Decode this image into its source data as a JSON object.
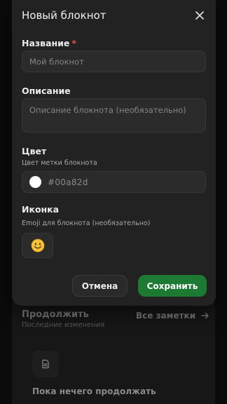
{
  "background": {
    "continue_title": "Продолжить",
    "continue_subtitle": "Последние изменения",
    "all_notes_link": "Все заметки",
    "empty_state": "Пока нечего продолжать"
  },
  "modal": {
    "title": "Новый блокнот",
    "name": {
      "label": "Название",
      "required_mark": "*",
      "placeholder": "Мой блокнот"
    },
    "description": {
      "label": "Описание",
      "placeholder": "Описание блокнота (необязательно)"
    },
    "color": {
      "label": "Цвет",
      "hint": "Цвет метки блокнота",
      "value": "#00a82d",
      "swatch_color": "#ffffff"
    },
    "icon": {
      "label": "Иконка",
      "hint": "Emoji для блокнота (необязательно)",
      "emoji_icon": "smiley-face-icon"
    },
    "cancel_label": "Отмена",
    "save_label": "Сохранить"
  },
  "colors": {
    "accent": "#1d7a33",
    "modal_bg": "#222222",
    "required": "#e05252"
  }
}
